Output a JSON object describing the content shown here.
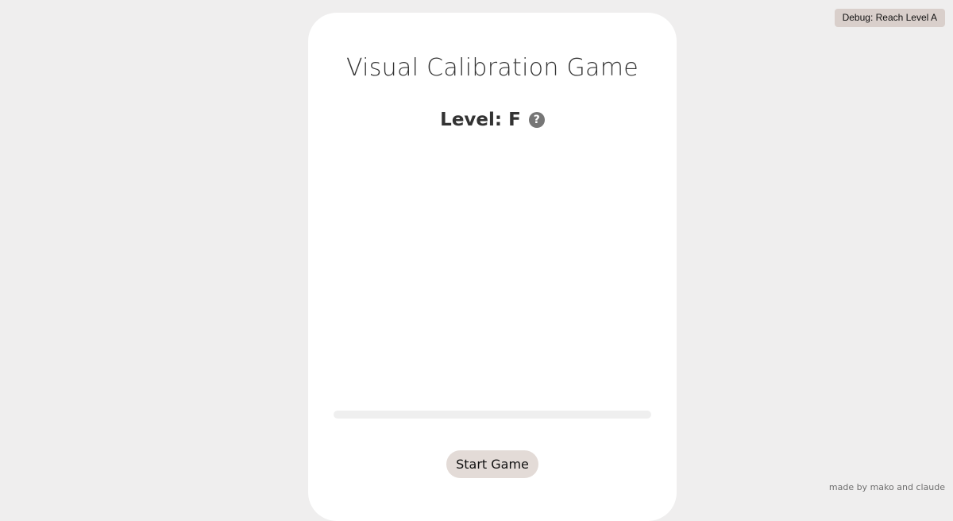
{
  "debug": {
    "label": "Debug: Reach Level A"
  },
  "game": {
    "title": "Visual Calibration Game",
    "level_label": "Level: F",
    "help_glyph": "?",
    "help_icon": "question-circle-icon",
    "progress_fraction": 0,
    "start_label": "Start Game"
  },
  "footer": {
    "credits": "made by mako and claude"
  },
  "colors": {
    "background": "#efeeee",
    "card": "#ffffff",
    "button": "#e3dbd7",
    "debug_button": "#d9cfcb",
    "text": "#333333"
  }
}
